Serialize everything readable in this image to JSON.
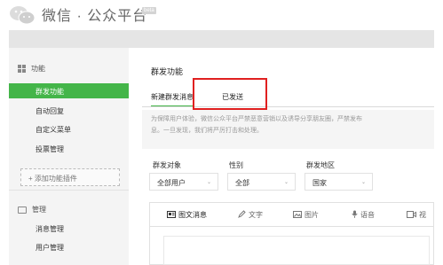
{
  "header": {
    "brand": "微信 · 公众平台",
    "beta": "beta"
  },
  "sidebar": {
    "group_function": "功能",
    "items_function": [
      {
        "label": "群发功能",
        "active": true
      },
      {
        "label": "自动回复",
        "active": false
      },
      {
        "label": "自定义菜单",
        "active": false
      },
      {
        "label": "投票管理",
        "active": false
      }
    ],
    "add_plugin": "+ 添加功能插件",
    "group_manage": "管理",
    "items_manage": [
      {
        "label": "消息管理"
      },
      {
        "label": "用户管理"
      }
    ]
  },
  "main": {
    "title": "群发功能",
    "tabs": [
      {
        "label": "新建群发消息",
        "active": true
      },
      {
        "label": "已发送",
        "active": false
      }
    ],
    "notice_line1": "为保障用户体验，微信公众平台严禁恶意营销以及诱导分享朋友圈，严禁发布",
    "notice_line2": "息。一旦发现，我们将严厉打击和处理。",
    "filters": {
      "target_label": "群发对象",
      "target_value": "全部用户",
      "gender_label": "性别",
      "gender_value": "全部",
      "region_label": "群发地区",
      "region_value": "国家"
    },
    "toolbar": [
      {
        "label": "图文消息",
        "icon": "news-icon"
      },
      {
        "label": "文字",
        "icon": "pen-icon"
      },
      {
        "label": "图片",
        "icon": "image-icon"
      },
      {
        "label": "语音",
        "icon": "microphone-icon"
      },
      {
        "label": "视",
        "icon": "video-icon"
      }
    ]
  },
  "colors": {
    "accent": "#44b549",
    "highlight": "#e02020"
  }
}
